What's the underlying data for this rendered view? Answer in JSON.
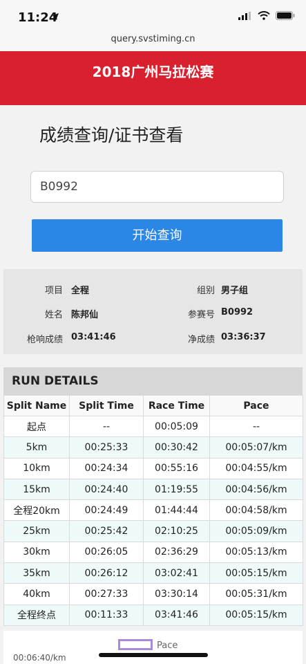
{
  "status": {
    "time": "11:24"
  },
  "browser": {
    "url": "query.svstiming.cn"
  },
  "banner": {
    "title": "2018广州马拉松赛"
  },
  "page": {
    "title": "成绩查询/证书查看"
  },
  "search": {
    "value": "B0992",
    "button": "开始查询"
  },
  "info": {
    "event_label": "项目",
    "event_value": "全程",
    "group_label": "组别",
    "group_value": "男子组",
    "name_label": "姓名",
    "name_value": "陈邦仙",
    "bib_label": "参赛号",
    "bib_value": "B0992",
    "gun_label": "枪响成绩",
    "gun_value": "03:41:46",
    "net_label": "净成绩",
    "net_value": "03:36:37"
  },
  "details": {
    "title": "RUN DETAILS",
    "headers": [
      "Split Name",
      "Split Time",
      "Race Time",
      "Pace"
    ],
    "rows": [
      [
        "起点",
        "--",
        "00:05:09",
        "--"
      ],
      [
        "5km",
        "00:25:33",
        "00:30:42",
        "00:05:07/km"
      ],
      [
        "10km",
        "00:24:34",
        "00:55:16",
        "00:04:55/km"
      ],
      [
        "15km",
        "00:24:40",
        "01:19:55",
        "00:04:56/km"
      ],
      [
        "全程20km",
        "00:24:49",
        "01:44:44",
        "00:04:58/km"
      ],
      [
        "25km",
        "00:25:42",
        "02:10:25",
        "00:05:09/km"
      ],
      [
        "30km",
        "00:26:05",
        "02:36:29",
        "00:05:13/km"
      ],
      [
        "35km",
        "00:26:12",
        "03:02:41",
        "00:05:15/km"
      ],
      [
        "40km",
        "00:27:33",
        "03:30:14",
        "00:05:31/km"
      ],
      [
        "全程终点",
        "00:11:33",
        "03:41:46",
        "00:05:15/km"
      ]
    ]
  },
  "chart": {
    "legend": "Pace",
    "y_tick": "00:06:40/km",
    "legend_color": "#a78bd8"
  },
  "colors": {
    "banner": "#d9202f",
    "button": "#2b86e6"
  }
}
